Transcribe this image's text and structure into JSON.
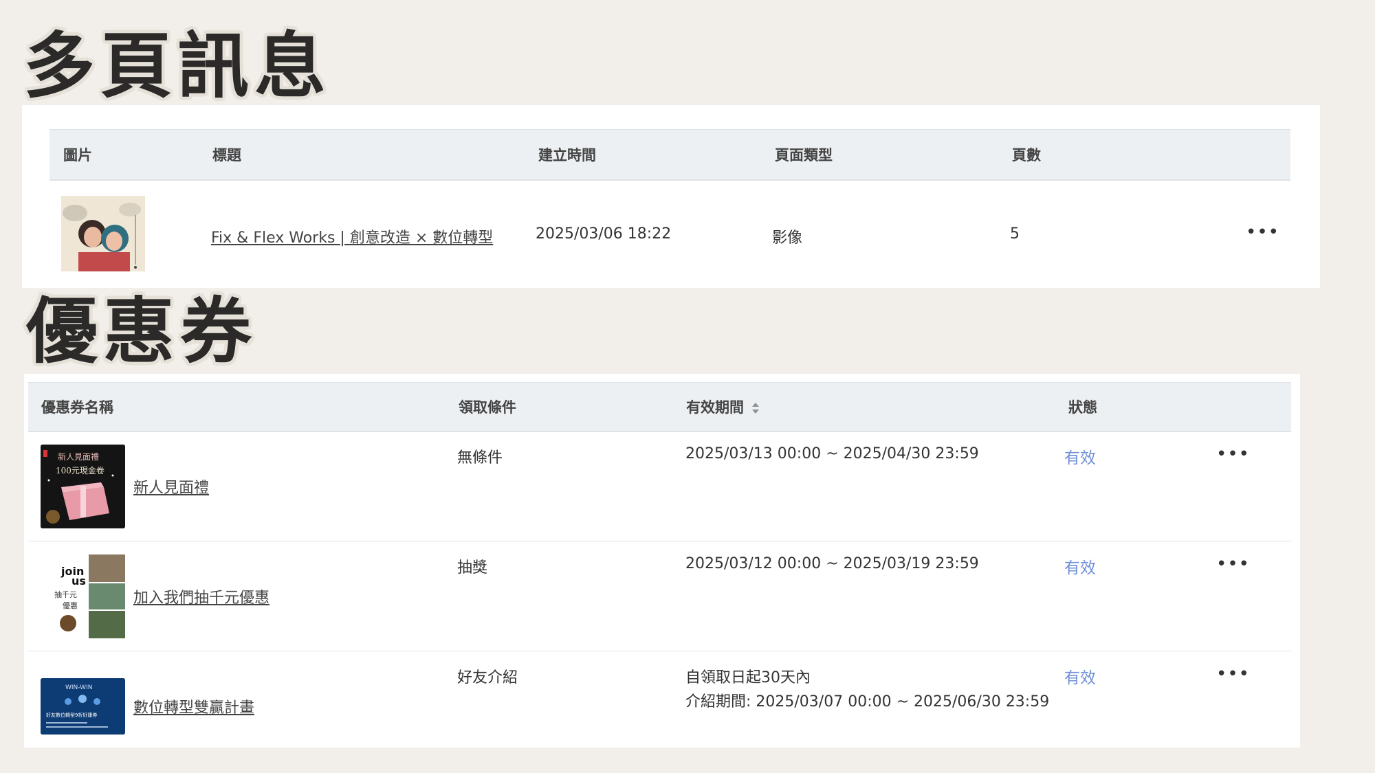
{
  "sections": {
    "multipage_title": "多頁訊息",
    "coupon_title": "優惠券"
  },
  "multipage": {
    "columns": [
      "圖片",
      "標題",
      "建立時間",
      "頁面類型",
      "頁數"
    ],
    "rows": [
      {
        "title": "Fix & Flex Works | 創意改造 × 數位轉型",
        "created": "2025/03/06 18:22",
        "type": "影像",
        "pages": "5"
      }
    ]
  },
  "coupons": {
    "columns": [
      "優惠券名稱",
      "領取條件",
      "有效期間",
      "狀態"
    ],
    "rows": [
      {
        "name": "新人見面禮",
        "condition": "無條件",
        "period": "2025/03/13 00:00 ~ 2025/04/30 23:59",
        "period2": "",
        "status": "有效",
        "thumb_text1": "新人見面禮",
        "thumb_text2": "100元現金卷"
      },
      {
        "name": "加入我們抽千元優惠",
        "condition": "抽獎",
        "period": "2025/03/12 00:00 ~ 2025/03/19 23:59",
        "period2": "",
        "status": "有效",
        "thumb_text1": "join",
        "thumb_text2": "us",
        "thumb_text3": "抽千元",
        "thumb_text4": "優惠"
      },
      {
        "name": "數位轉型雙贏計畫",
        "condition": "好友介紹",
        "period": "自領取日起30天內",
        "period2": "介紹期間: 2025/03/07 00:00 ~ 2025/06/30 23:59",
        "status": "有效",
        "thumb_text1": "WIN-WIN",
        "thumb_text2": "好友數位轉型9折好康券"
      }
    ]
  },
  "colors": {
    "background": "#f2efea",
    "header_bg": "#edf0f2",
    "status_active": "#6f8fd9"
  },
  "icons": {
    "more": "more-horizontal-icon",
    "sort": "sort-icon"
  }
}
